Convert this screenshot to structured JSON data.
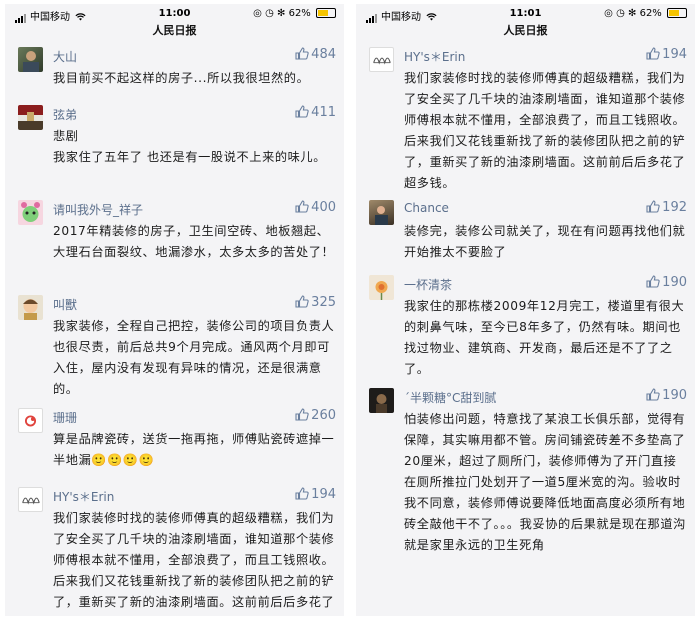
{
  "screens": [
    {
      "status_bar": {
        "carrier": "中国移动",
        "time": "11:00",
        "battery": "62%",
        "battery_level": 0.62
      },
      "title": "人民日报",
      "comments": [
        {
          "user": "大山",
          "likes": "484",
          "text": "我目前买不起这样的房子...所以我很坦然的。"
        },
        {
          "user": "弦弟",
          "likes": "411",
          "text": "悲剧\n我家住了五年了 也还是有一股说不上来的味儿。"
        },
        {
          "user": "请叫我外号_祥子",
          "likes": "400",
          "text": "2017年精装修的房子，卫生间空砖、地板翘起、大理石台面裂纹、地漏渗水，太多太多的苦处了！"
        },
        {
          "user": "叫獸",
          "likes": "325",
          "text": "我家装修，全程自己把控，装修公司的项目负责人也很尽责，前后总共9个月完成。通风两个月即可入住，屋内没有发现有异味的情况，还是很满意的。"
        },
        {
          "user": "珊珊",
          "likes": "260",
          "text": "算是品牌瓷砖，送货一拖再拖，师傅贴瓷砖遮掉一半地漏🙂🙂🙂🙂"
        },
        {
          "user": "HY's＊Erin",
          "likes": "194",
          "text": "我们家装修时找的装修师傅真的超级糟糕，我们为了安全买了几千块的油漆刷墙面，谁知道那个装修师傅根本就不懂用，全部浪费了，而且工钱照收。后来我们又花钱重新找了新的装修团队把之前的铲了，重新买了新的油漆刷墙面。这前前后后多花了超多钱。"
        }
      ]
    },
    {
      "status_bar": {
        "carrier": "中国移动",
        "time": "11:01",
        "battery": "62%",
        "battery_level": 0.62
      },
      "title": "人民日报",
      "comments": [
        {
          "user": "HY's＊Erin",
          "likes": "194",
          "text": "我们家装修时找的装修师傅真的超级糟糕，我们为了安全买了几千块的油漆刷墙面，谁知道那个装修师傅根本就不懂用，全部浪费了，而且工钱照收。后来我们又花钱重新找了新的装修团队把之前的铲了，重新买了新的油漆刷墙面。这前前后后多花了超多钱。"
        },
        {
          "user": "Chance",
          "likes": "192",
          "text": "装修完，装修公司就关了，现在有问题再找他们就开始推太不要脸了"
        },
        {
          "user": "一杯清茶",
          "likes": "190",
          "text": "我家住的那栋楼2009年12月完工，楼道里有很大的刺鼻气味，至今已8年多了，仍然有味。期间也找过物业、建筑商、开发商，最后还是不了了之了。"
        },
        {
          "user": "´半颗糖°C甜到腻",
          "likes": "190",
          "text": "怕装修出问题，特意找了某浪工长俱乐部，觉得有保障，其实嘛用都不管。房间铺瓷砖差不多垫高了20厘米，超过了厕所门，装修师傅为了开门直接在厕所推拉门处划开了一道5厘米宽的沟。验收时我不同意，装修师傅说要降低地面高度必须所有地砖全敲他干不了。。。我妥协的后果就是现在那道沟就是家里永远的卫生死角"
        }
      ]
    }
  ],
  "icons": {
    "like": "thumbs-up-icon",
    "signal": "signal-bars-icon",
    "wifi": "wifi-icon",
    "battery": "battery-icon",
    "lock": "rotation-lock-icon",
    "alarm": "alarm-icon",
    "bluetooth": "bluetooth-icon"
  },
  "colors": {
    "username": "#5b6f8c",
    "likes": "#6a7f9e",
    "background": "#f4f4f6",
    "battery_fill": "#f5c400"
  }
}
